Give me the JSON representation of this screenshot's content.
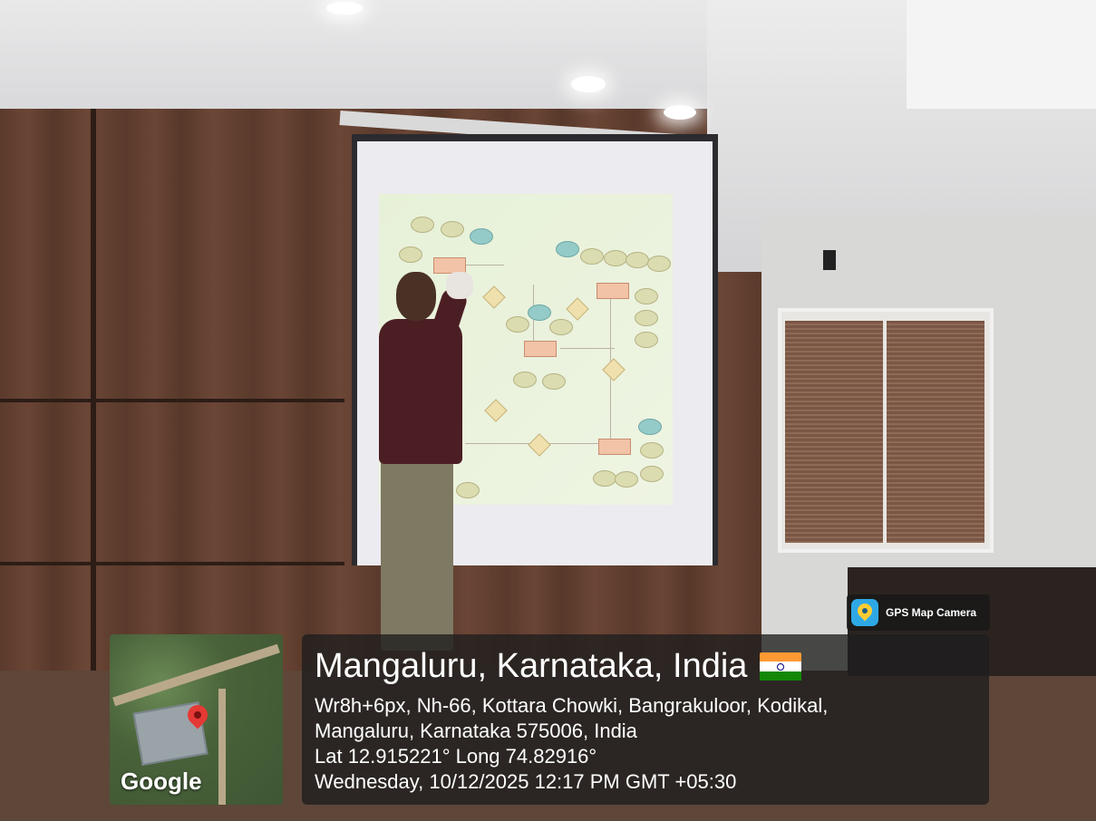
{
  "location": {
    "title": "Mangaluru, Karnataka, India",
    "address_line1": "Wr8h+6px, Nh-66, Kottara Chowki, Bangrakuloor, Kodikal,",
    "address_line2": "Mangaluru, Karnataka 575006, India",
    "coordinates": "Lat 12.915221° Long 74.82916°",
    "datetime": "Wednesday, 10/12/2025 12:17 PM GMT +05:30"
  },
  "map": {
    "logo_text": "Google",
    "pin_color": "#e53935"
  },
  "app_badge": {
    "label": "GPS Map Camera",
    "icon": "gps-map-camera-icon"
  },
  "flag": {
    "icon": "india-flag-icon",
    "colors": [
      "#ff9933",
      "#ffffff",
      "#138808"
    ]
  }
}
